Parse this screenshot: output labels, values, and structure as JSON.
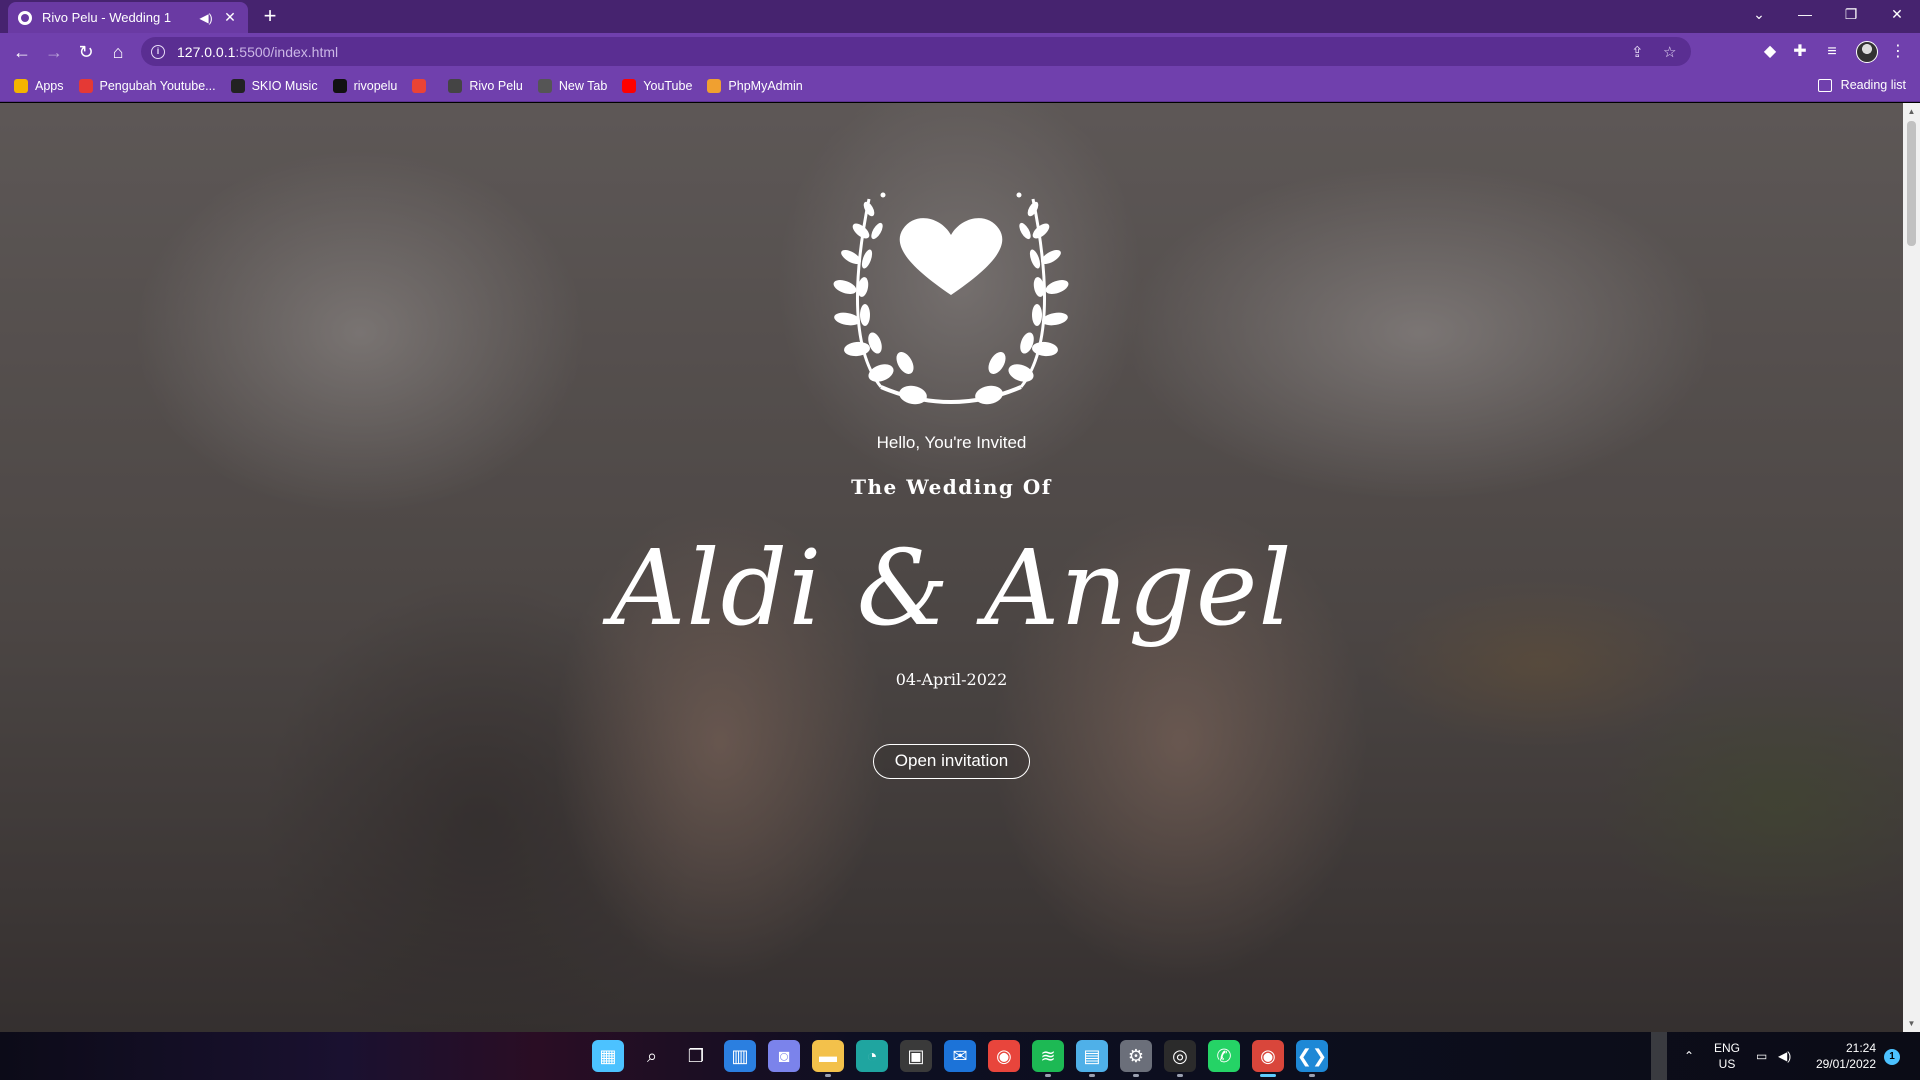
{
  "browser": {
    "tab_title": "Rivo Pelu - Wedding 1",
    "url_host": "127.0.0.1",
    "url_rest": ":5500/index.html",
    "bookmarks": [
      {
        "label": "Apps",
        "icon": "apps-grid-icon",
        "color": "#f4b400"
      },
      {
        "label": "Pengubah Youtube...",
        "icon": "youtube-converter-icon",
        "color": "#e53935"
      },
      {
        "label": "SKIO Music",
        "icon": "infinity-icon",
        "color": "#222222"
      },
      {
        "label": "rivopelu",
        "icon": "github-icon",
        "color": "#111111"
      },
      {
        "label": "",
        "icon": "gmail-icon",
        "color": "#ea4335"
      },
      {
        "label": "Rivo Pelu",
        "icon": "spiral-icon",
        "color": "#444444"
      },
      {
        "label": "New Tab",
        "icon": "globe-icon",
        "color": "#555555"
      },
      {
        "label": "YouTube",
        "icon": "youtube-icon",
        "color": "#ff0000"
      },
      {
        "label": "PhpMyAdmin",
        "icon": "phpmyadmin-icon",
        "color": "#f0a030"
      }
    ],
    "reading_list": "Reading list",
    "colors": {
      "titlebar": "#46236f",
      "toolbar": "#7040ad"
    }
  },
  "hero": {
    "greeting": "Hello, You're Invited",
    "subtitle": "The Wedding Of",
    "couple_names": "Aldi & Angel",
    "date": "04-April-2022",
    "cta_label": "Open invitation",
    "emblem": "heart-wreath-icon"
  },
  "taskbar": {
    "apps": [
      "windows-start-icon",
      "search-icon",
      "task-view-icon",
      "widgets-icon",
      "teams-chat-icon",
      "file-explorer-icon",
      "edge-icon",
      "store-icon",
      "mail-icon",
      "chrome-icon",
      "spotify-icon",
      "notepad-icon",
      "settings-icon",
      "obs-icon",
      "whatsapp-icon",
      "chrome-profile-icon",
      "vscode-icon"
    ],
    "lang_top": "ENG",
    "lang_bottom": "US",
    "time": "21:24",
    "date": "29/01/2022",
    "notifications": "1"
  }
}
